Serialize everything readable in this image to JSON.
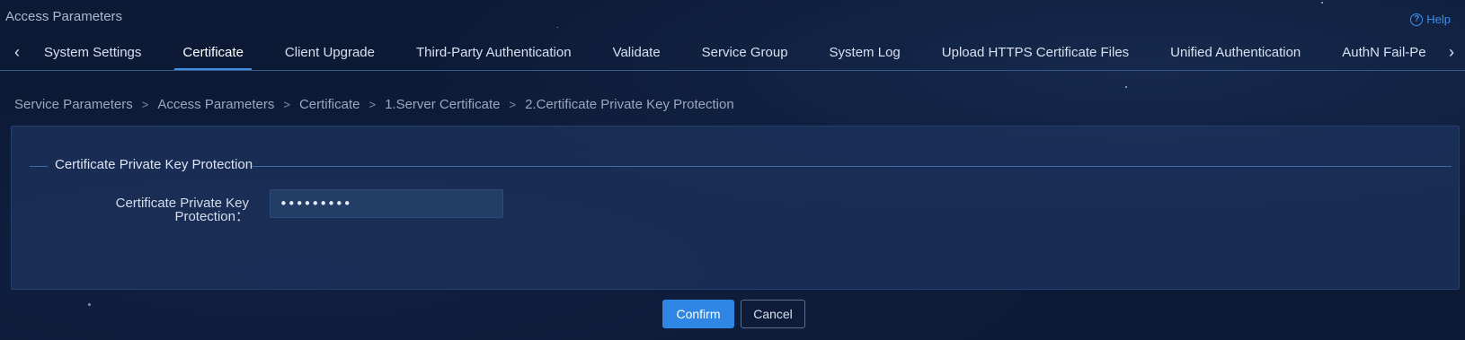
{
  "page": {
    "title": "Access Parameters",
    "help": "Help"
  },
  "tabs": [
    {
      "label": "System Settings"
    },
    {
      "label": "Certificate"
    },
    {
      "label": "Client Upgrade"
    },
    {
      "label": "Third-Party Authentication"
    },
    {
      "label": "Validate"
    },
    {
      "label": "Service Group"
    },
    {
      "label": "System Log"
    },
    {
      "label": "Upload HTTPS Certificate Files"
    },
    {
      "label": "Unified Authentication"
    },
    {
      "label": "AuthN Fail-Pe"
    }
  ],
  "active_tab": "Certificate",
  "breadcrumb": {
    "items": [
      "Service Parameters",
      "Access Parameters",
      "Certificate",
      "1.Server Certificate",
      "2.Certificate Private Key Protection"
    ],
    "separator": ">"
  },
  "section": {
    "title": "Certificate Private Key Protection",
    "field_label": "Certificate Private Key Protection：",
    "field_value": "•••••••••"
  },
  "buttons": {
    "confirm": "Confirm",
    "cancel": "Cancel"
  },
  "colors": {
    "background": "#0c1a36",
    "accent": "#2f86e4",
    "panel": "#1c325c"
  },
  "icons": {
    "help": "help-circle-icon",
    "tab_prev": "chevron-left-icon",
    "tab_next": "chevron-right-icon"
  }
}
